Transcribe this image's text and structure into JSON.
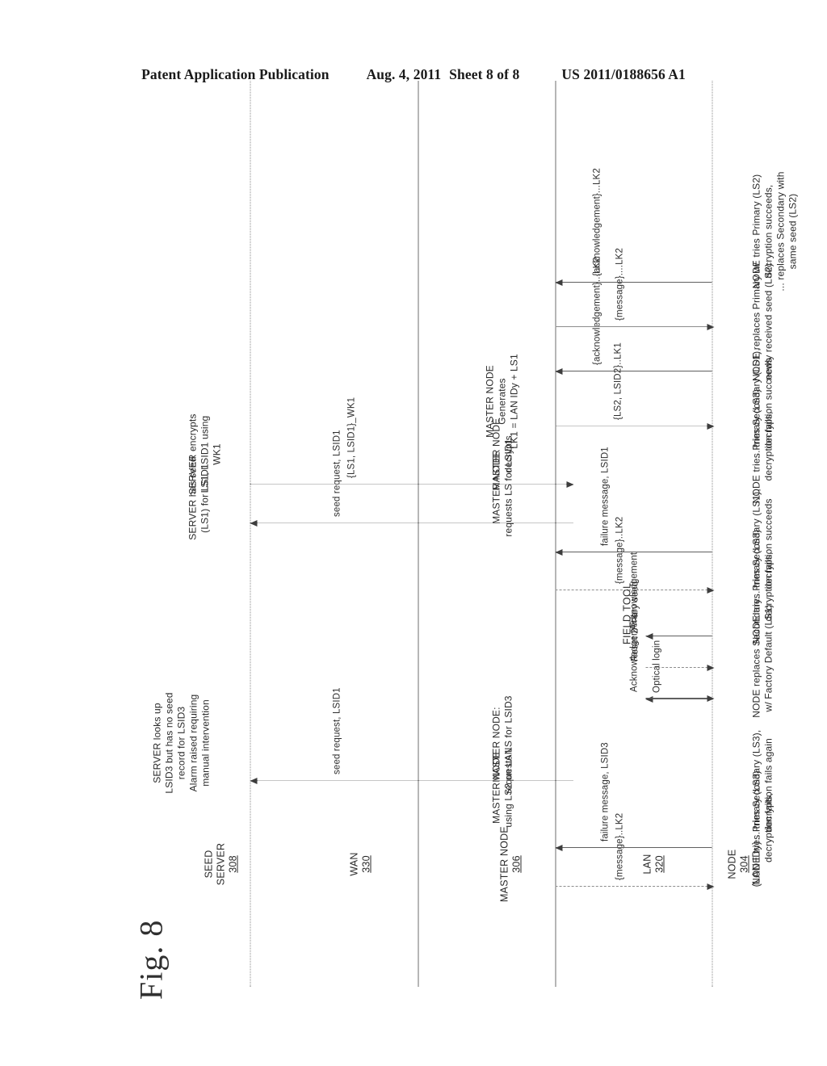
{
  "header": {
    "publication": "Patent Application Publication",
    "date": "Aug. 4, 2011",
    "sheet": "Sheet 8 of 8",
    "number": "US 2011/0188656 A1"
  },
  "figure": {
    "label": "Fig. 8"
  },
  "lanes": [
    {
      "id": "seed-server",
      "name": "SEED SERVER",
      "line1": "SEED",
      "line2": "SERVER",
      "num": "308"
    },
    {
      "id": "wan",
      "name": "WAN",
      "line1": "WAN",
      "line2": "",
      "num": "330"
    },
    {
      "id": "master-node",
      "name": "MASTER NODE",
      "line1": "MASTER NODE",
      "line2": "",
      "num": "306"
    },
    {
      "id": "lan",
      "name": "LAN",
      "line1": "LAN",
      "line2": "",
      "num": "320"
    },
    {
      "id": "node",
      "name": "NODE",
      "line1": "NODE",
      "line2": "(LAN IDy)",
      "num": "304"
    }
  ],
  "field_tool_label": "FIELD TOOL",
  "messages": [
    {
      "id": "m1",
      "label": "{message}..LK2"
    },
    {
      "id": "m2",
      "label": "failure message, LSID3"
    },
    {
      "id": "m3",
      "label": "seed request, LSID1"
    },
    {
      "id": "m4",
      "label": "Optical login"
    },
    {
      "id": "m5",
      "label": "Acknowledgement"
    },
    {
      "id": "m6",
      "label": "Reset 2nd-ary seed",
      "sup": "nd"
    },
    {
      "id": "m7",
      "label": "Acknowledgement"
    },
    {
      "id": "m8",
      "label": "{message}..LK2"
    },
    {
      "id": "m9",
      "label": "failure message, LSID1"
    },
    {
      "id": "m10",
      "label": "seed request, LSID1"
    },
    {
      "id": "m11",
      "label": "{LS1, LSID1}_WK1"
    },
    {
      "id": "m12",
      "label": "{LS2, LSID2}..LK1"
    },
    {
      "id": "m13",
      "label": "{acknowledgement}...LK2"
    },
    {
      "id": "m14",
      "label": "{message}....LK2"
    },
    {
      "id": "m15",
      "label": "{acknowledgement}...LK2"
    }
  ],
  "server_notes": [
    {
      "id": "sn1",
      "text": "SERVER looks up\nLSID3 but has no seed\nrecord for LSID3\nAlarm raised requiring\nmanual intervention"
    },
    {
      "id": "sn2",
      "text": "SERVER has seed\n(LS1) for LSID1"
    },
    {
      "id": "sn3",
      "text": "SERVER encrypts\nLS1, LSID1 using\nWK1"
    }
  ],
  "master_notes": [
    {
      "id": "mn1",
      "text": "MASTER NODE\nusing LS2 on LAN"
    },
    {
      "id": "mn2",
      "text": "MASTER NODE:\nrequests LS for LSID3"
    },
    {
      "id": "mn3",
      "text": "MASTER NODE\nrequests LS for LSID1"
    },
    {
      "id": "mn4",
      "text": "MASTER NODE\ndecrypts"
    },
    {
      "id": "mn5",
      "text": "MASTER NODE\nGenerates\nLK1 = LAN IDy + LS1"
    }
  ],
  "node_notes": [
    {
      "id": "nn1",
      "text": "NODE tries Primary (LS3)\ndecryption fails,"
    },
    {
      "id": "nn2",
      "text": "... tries Secondary (LS3),\ndecryption fails again"
    },
    {
      "id": "nn3",
      "text": "NODE replaces Secondary\nw/ Factory Default (LS1)"
    },
    {
      "id": "nn4",
      "text": "NODE tries Primary (LS3)\ndecryption fails,"
    },
    {
      "id": "nn5",
      "text": "... tries Secondary (LS1),\ndecryption succeeds"
    },
    {
      "id": "nn6",
      "text": "NODE tries Primary (LS3)\ndecryption fails,"
    },
    {
      "id": "nn7",
      "text": "... tries Secondary (LS1),\ndecryption succeeds"
    },
    {
      "id": "nn8",
      "text": "NODE replaces Primary w/\nnewly received seed (LS2)"
    },
    {
      "id": "nn9",
      "text": "NODE tries Primary (LS2)\ndecryption succeeds,\n... replaces Secondary with\nsame seed (LS2)"
    }
  ]
}
